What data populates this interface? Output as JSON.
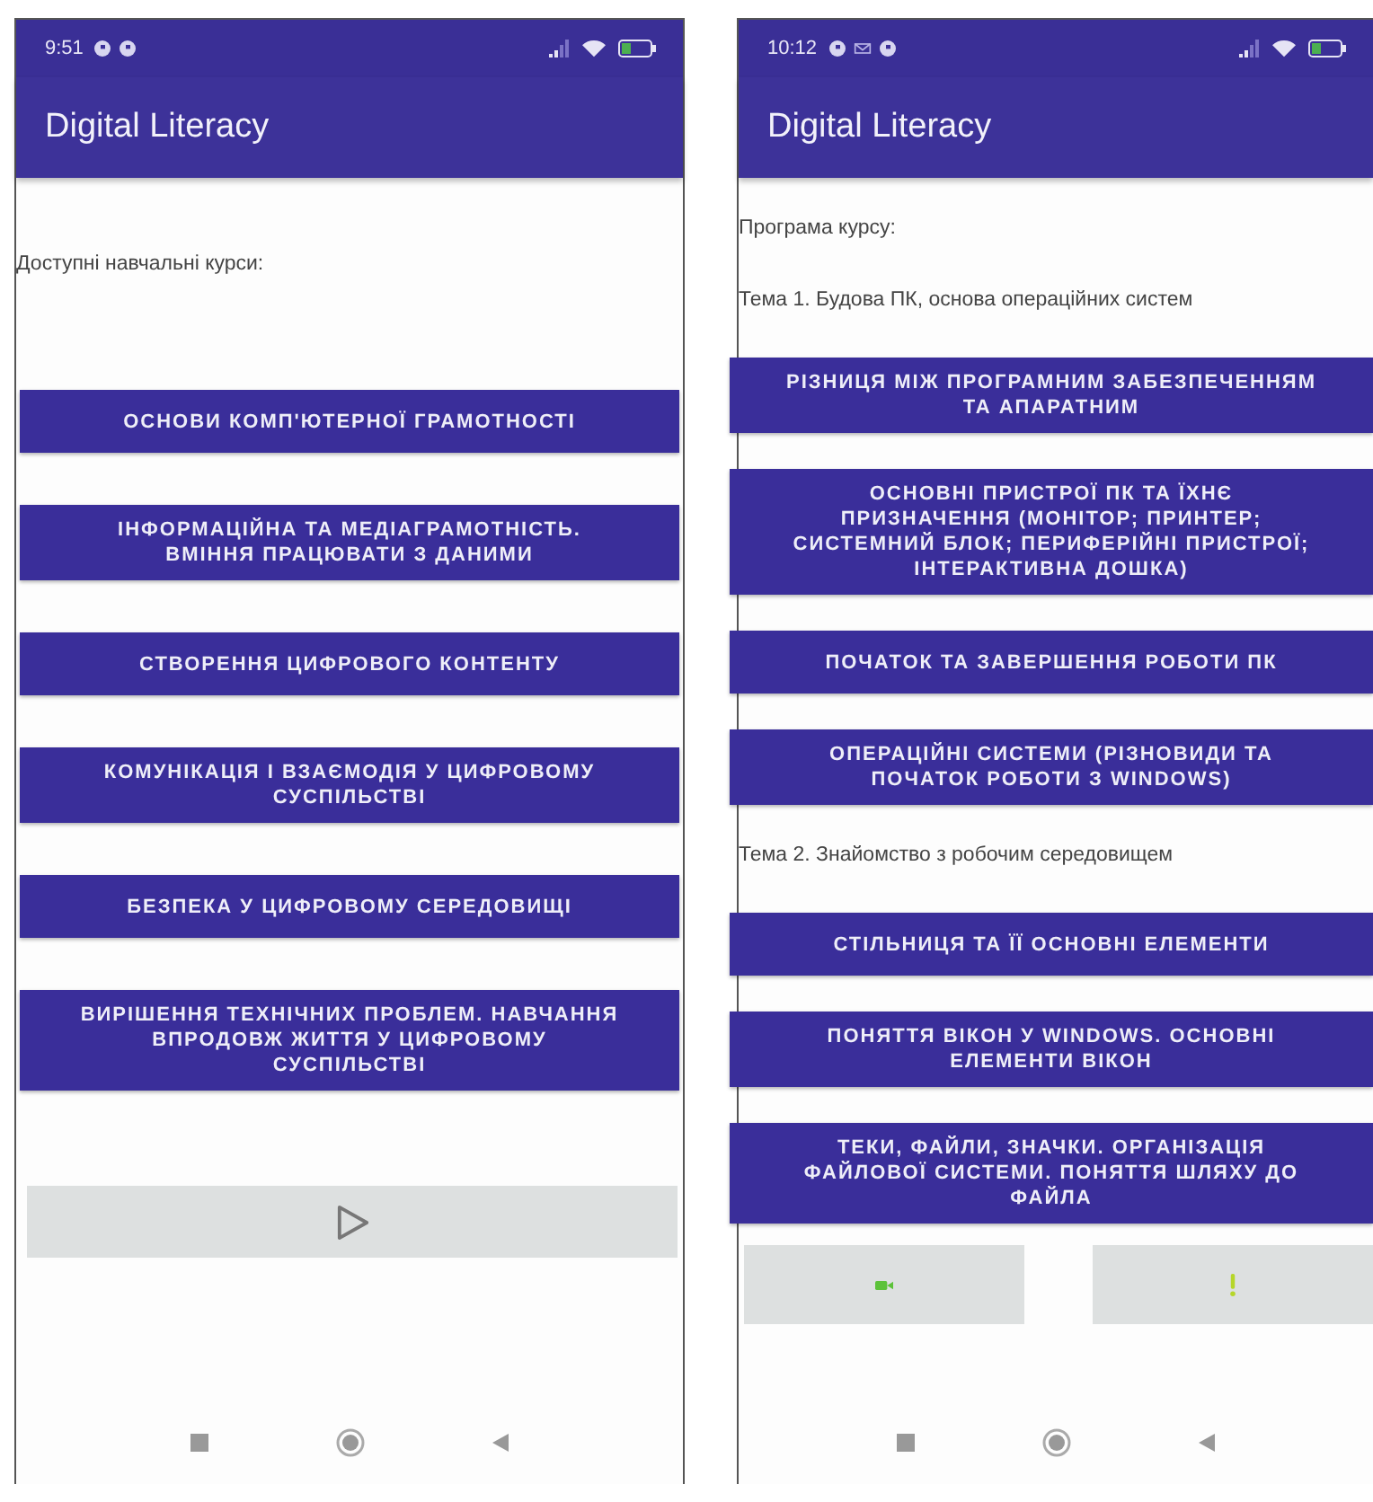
{
  "phones": [
    {
      "status_bar": {
        "time": "9:51",
        "notifications": [
          {
            "kind": "app"
          },
          {
            "kind": "app"
          }
        ]
      },
      "app_bar": {
        "title": "Digital Literacy"
      },
      "content": [
        {
          "kind": "label",
          "text": "Доступні навчальні курси:"
        },
        {
          "kind": "button",
          "text": "ОСНОВИ КОМП'ЮТЕРНОЇ ГРАМОТНОСТІ"
        },
        {
          "kind": "button",
          "text": "ІНФОРМАЦІЙНА ТА МЕДІАГРАМОТНІСТЬ. ВМІННЯ ПРАЦЮВАТИ З ДАНИМИ"
        },
        {
          "kind": "button",
          "text": "СТВОРЕННЯ ЦИФРОВОГО  КОНТЕНТУ"
        },
        {
          "kind": "button",
          "text": "КОМУНІКАЦІЯ І ВЗАЄМОДІЯ У ЦИФРОВОМУ СУСПІЛЬСТВІ"
        },
        {
          "kind": "button",
          "text": "БЕЗПЕКА У ЦИФРОВОМУ  СЕРЕДОВИЩІ"
        },
        {
          "kind": "button",
          "text": "ВИРІШЕННЯ ТЕХНІЧНИХ ПРОБЛЕМ. НАВЧАННЯ ВПРОДОВЖ ЖИТТЯ У ЦИФРОВОМУ СУСПІЛЬСТВІ"
        }
      ],
      "bottom_buttons": [
        {
          "kind": "play"
        }
      ]
    },
    {
      "status_bar": {
        "time": "10:12",
        "notifications": [
          {
            "kind": "app"
          },
          {
            "kind": "mail"
          },
          {
            "kind": "app"
          }
        ]
      },
      "app_bar": {
        "title": "Digital Literacy"
      },
      "content": [
        {
          "kind": "label",
          "text": "Програма курсу:"
        },
        {
          "kind": "label",
          "text": "Тема 1. Будова ПК, основа операційних систем"
        },
        {
          "kind": "button",
          "text": "РІЗНИЦЯ МІЖ ПРОГРАМНИМ ЗАБЕЗПЕЧЕННЯМ ТА АПАРАТНИМ"
        },
        {
          "kind": "button",
          "text": "ОСНОВНІ ПРИСТРОЇ ПК ТА ЇХНЄ ПРИЗНАЧЕННЯ (МОНІТОР; ПРИНТЕР; СИСТЕМНИЙ БЛОК; ПЕРИФЕРІЙНІ ПРИСТРОЇ; ІНТЕРАКТИВНА ДОШКА)"
        },
        {
          "kind": "button",
          "text": "ПОЧАТОК ТА ЗАВЕРШЕННЯ РОБОТИ ПК"
        },
        {
          "kind": "button",
          "text": "ОПЕРАЦІЙНІ СИСТЕМИ (РІЗНОВИДИ ТА ПОЧАТОК РОБОТИ З WINDOWS)"
        },
        {
          "kind": "label",
          "text": "Тема 2. Знайомство з робочим середовищем"
        },
        {
          "kind": "button",
          "text": "СТІЛЬНИЦЯ ТА ЇЇ ОСНОВНІ ЕЛЕМЕНТИ"
        },
        {
          "kind": "button",
          "text": "ПОНЯТТЯ ВІКОН У WINDOWS. ОСНОВНІ ЕЛЕМЕНТИ ВІКОН"
        },
        {
          "kind": "button",
          "text": "ТЕКИ, ФАЙЛИ, ЗНАЧКИ. ОРГАНІЗАЦІЯ ФАЙЛОВОЇ СИСТЕМИ. ПОНЯТТЯ ШЛЯХУ ДО ФАЙЛА"
        }
      ],
      "bottom_buttons": [
        {
          "kind": "camera"
        },
        {
          "kind": "alert"
        }
      ]
    }
  ]
}
